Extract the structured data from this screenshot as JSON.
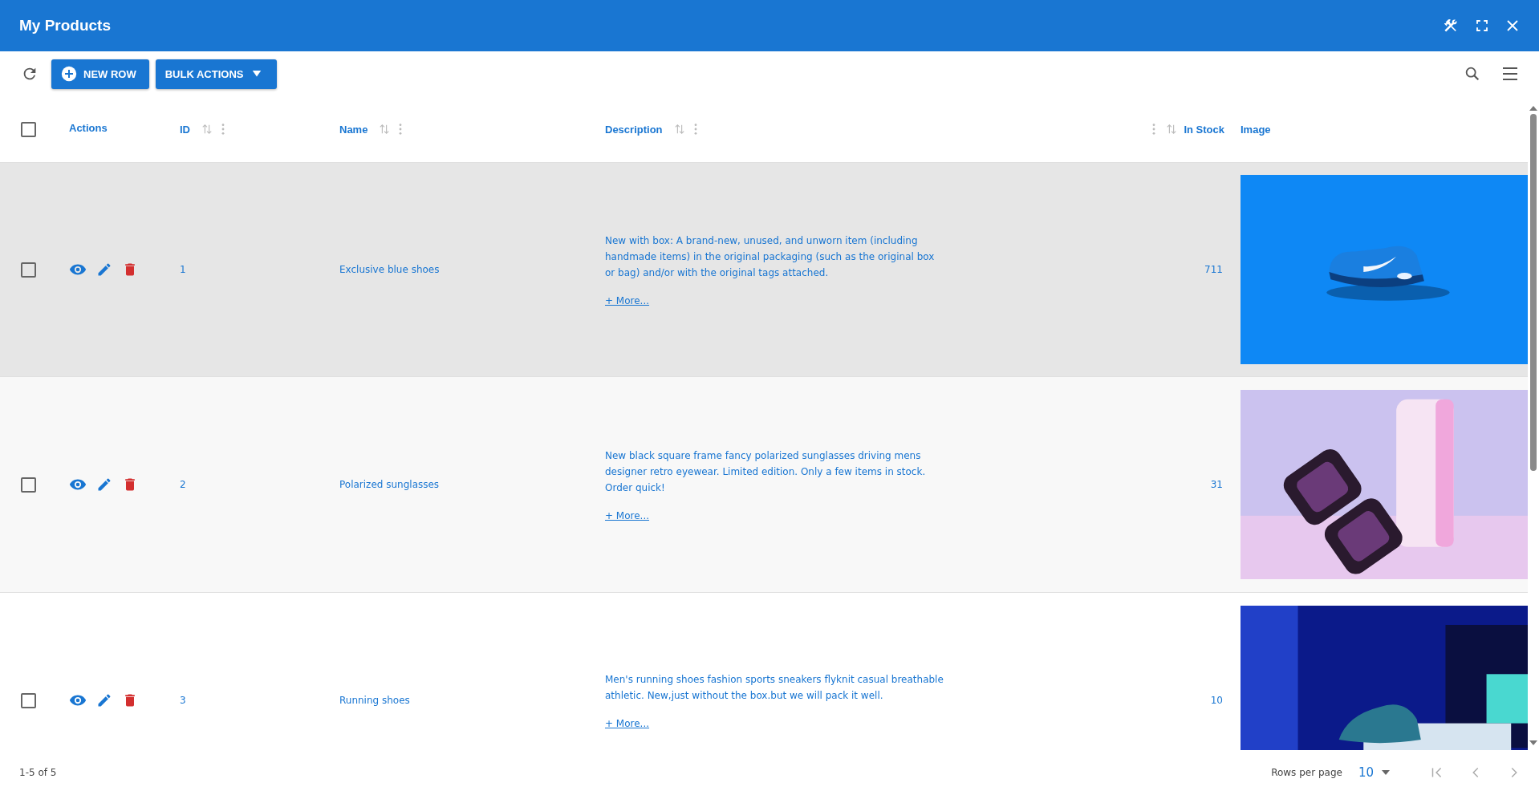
{
  "window": {
    "title": "My Products"
  },
  "toolbar": {
    "new_row": "NEW ROW",
    "bulk_actions": "BULK ACTIONS"
  },
  "table": {
    "select_all_checked": false,
    "columns": [
      {
        "label": "Actions",
        "kind": "plain"
      },
      {
        "label": "ID",
        "kind": "sortable"
      },
      {
        "label": "Name",
        "kind": "sortable"
      },
      {
        "label": "Description",
        "kind": "sortable"
      },
      {
        "label": "In Stock",
        "kind": "sortable-right"
      },
      {
        "label": "Image",
        "kind": "plain"
      }
    ],
    "rows": [
      {
        "checked": false,
        "hovered": true,
        "id": "1",
        "name": "Exclusive blue shoes",
        "description": "New with box: A brand-new, unused, and unworn item (including handmade items) in the original packaging (such as the original box or bag) and/or with the original tags attached.",
        "more": "+ More...",
        "in_stock": "711"
      },
      {
        "checked": false,
        "hovered": false,
        "id": "2",
        "name": "Polarized sunglasses",
        "description": "New black square frame fancy polarized sunglasses driving mens designer retro eyewear. Limited edition. Only a few items in stock. Order quick!",
        "more": "+ More...",
        "in_stock": "31"
      },
      {
        "checked": false,
        "hovered": false,
        "id": "3",
        "name": "Running shoes",
        "description": "Men's running shoes fashion sports sneakers flyknit casual breathable athletic. New,just without the box.but we will pack it well.",
        "more": "+ More...",
        "in_stock": "10"
      }
    ]
  },
  "footer": {
    "range": "1-5 of 5",
    "rows_per_page_label": "Rows per page",
    "rows_per_page": "10"
  }
}
